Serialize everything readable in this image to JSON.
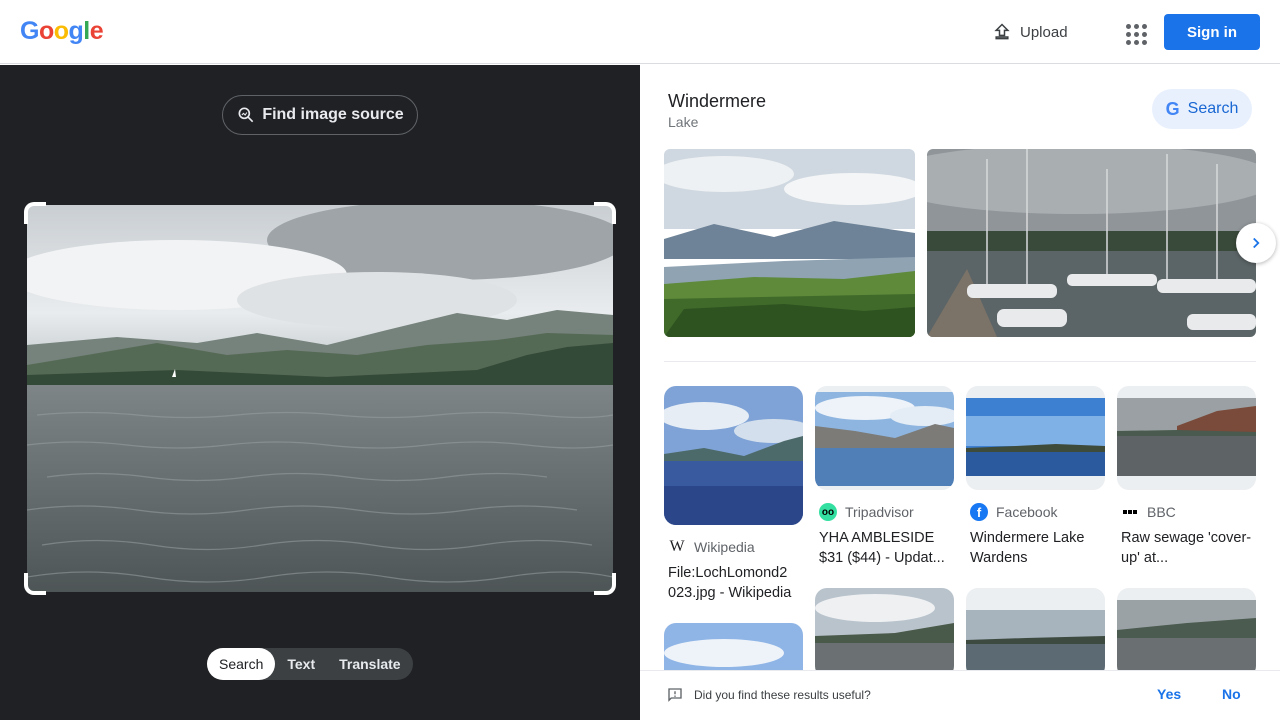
{
  "header": {
    "logo_letters": [
      "G",
      "o",
      "o",
      "g",
      "l",
      "e"
    ],
    "upload_label": "Upload",
    "signin_label": "Sign in"
  },
  "left_panel": {
    "find_source_label": "Find image source",
    "tabs": [
      {
        "label": "Search",
        "active": true
      },
      {
        "label": "Text",
        "active": false
      },
      {
        "label": "Translate",
        "active": false
      }
    ]
  },
  "entity": {
    "title": "Windermere",
    "subtitle": "Lake",
    "search_label": "Search"
  },
  "results": [
    {
      "source": "Wikipedia",
      "source_icon": "wikipedia-icon",
      "title": "File:LochLomond2 023.jpg - Wikipedia"
    },
    {
      "source": "Tripadvisor",
      "source_icon": "tripadvisor-icon",
      "title": "YHA AMBLESIDE $31 ($44) - Updat..."
    },
    {
      "source": "Facebook",
      "source_icon": "facebook-icon",
      "title": "Windermere Lake Wardens"
    },
    {
      "source": "BBC",
      "source_icon": "bbc-icon",
      "title": "Raw sewage 'cover-up' at..."
    }
  ],
  "feedback": {
    "question": "Did you find these results useful?",
    "yes_label": "Yes",
    "no_label": "No"
  },
  "colors": {
    "accent": "#1a73e8",
    "left_bg": "#202124",
    "google_blue": "#4285f4",
    "google_red": "#ea4335",
    "google_yellow": "#fbbc05",
    "google_green": "#34a853"
  }
}
